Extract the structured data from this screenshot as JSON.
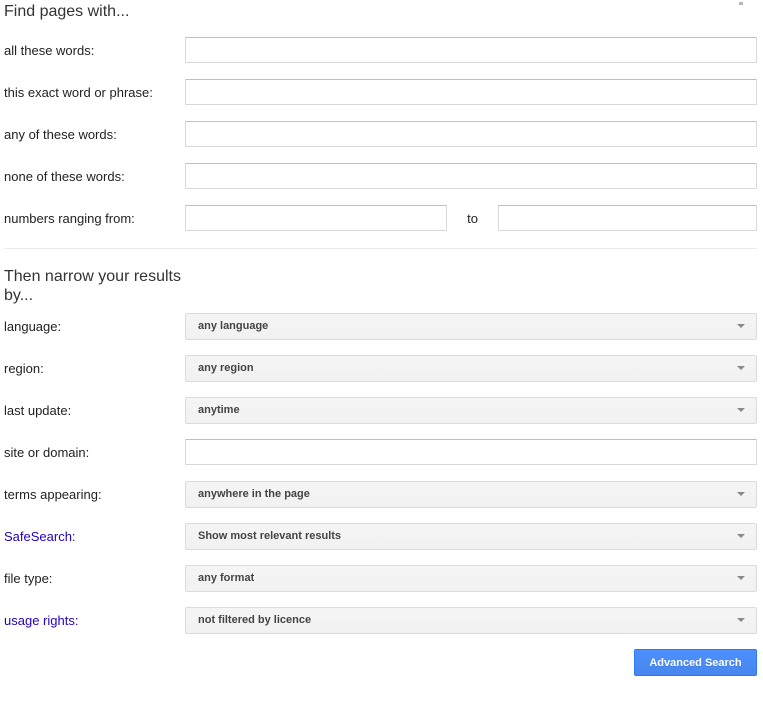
{
  "colors": {
    "link": "#2200c1",
    "button_bg": "#4d90fe",
    "button_border": "#3079ed",
    "select_text": "#444444",
    "heading_text": "#333333"
  },
  "find": {
    "heading": "Find pages with...",
    "rows": [
      {
        "label": "all these words:",
        "value": ""
      },
      {
        "label": "this exact word or phrase:",
        "value": ""
      },
      {
        "label": "any of these words:",
        "value": ""
      },
      {
        "label": "none of these words:",
        "value": ""
      }
    ],
    "numbers_row": {
      "label": "numbers ranging from:",
      "low_value": "",
      "to_label": "to",
      "high_value": ""
    }
  },
  "narrow": {
    "heading": "Then narrow your results by...",
    "rows": [
      {
        "label": "language:",
        "value": "any language",
        "kind": "select"
      },
      {
        "label": "region:",
        "value": "any region",
        "kind": "select"
      },
      {
        "label": "last update:",
        "value": "anytime",
        "kind": "select"
      },
      {
        "label": "site or domain:",
        "value": "",
        "kind": "input"
      },
      {
        "label": "terms appearing:",
        "value": "anywhere in the page",
        "kind": "select"
      },
      {
        "label": "SafeSearch:",
        "value": "Show most relevant results",
        "kind": "select",
        "label_is_link": true
      },
      {
        "label": "file type:",
        "value": "any format",
        "kind": "select"
      },
      {
        "label": "usage rights:",
        "value": "not filtered by licence",
        "kind": "select",
        "label_is_link": true
      }
    ]
  },
  "footer": {
    "advanced_search_label": "Advanced Search"
  }
}
